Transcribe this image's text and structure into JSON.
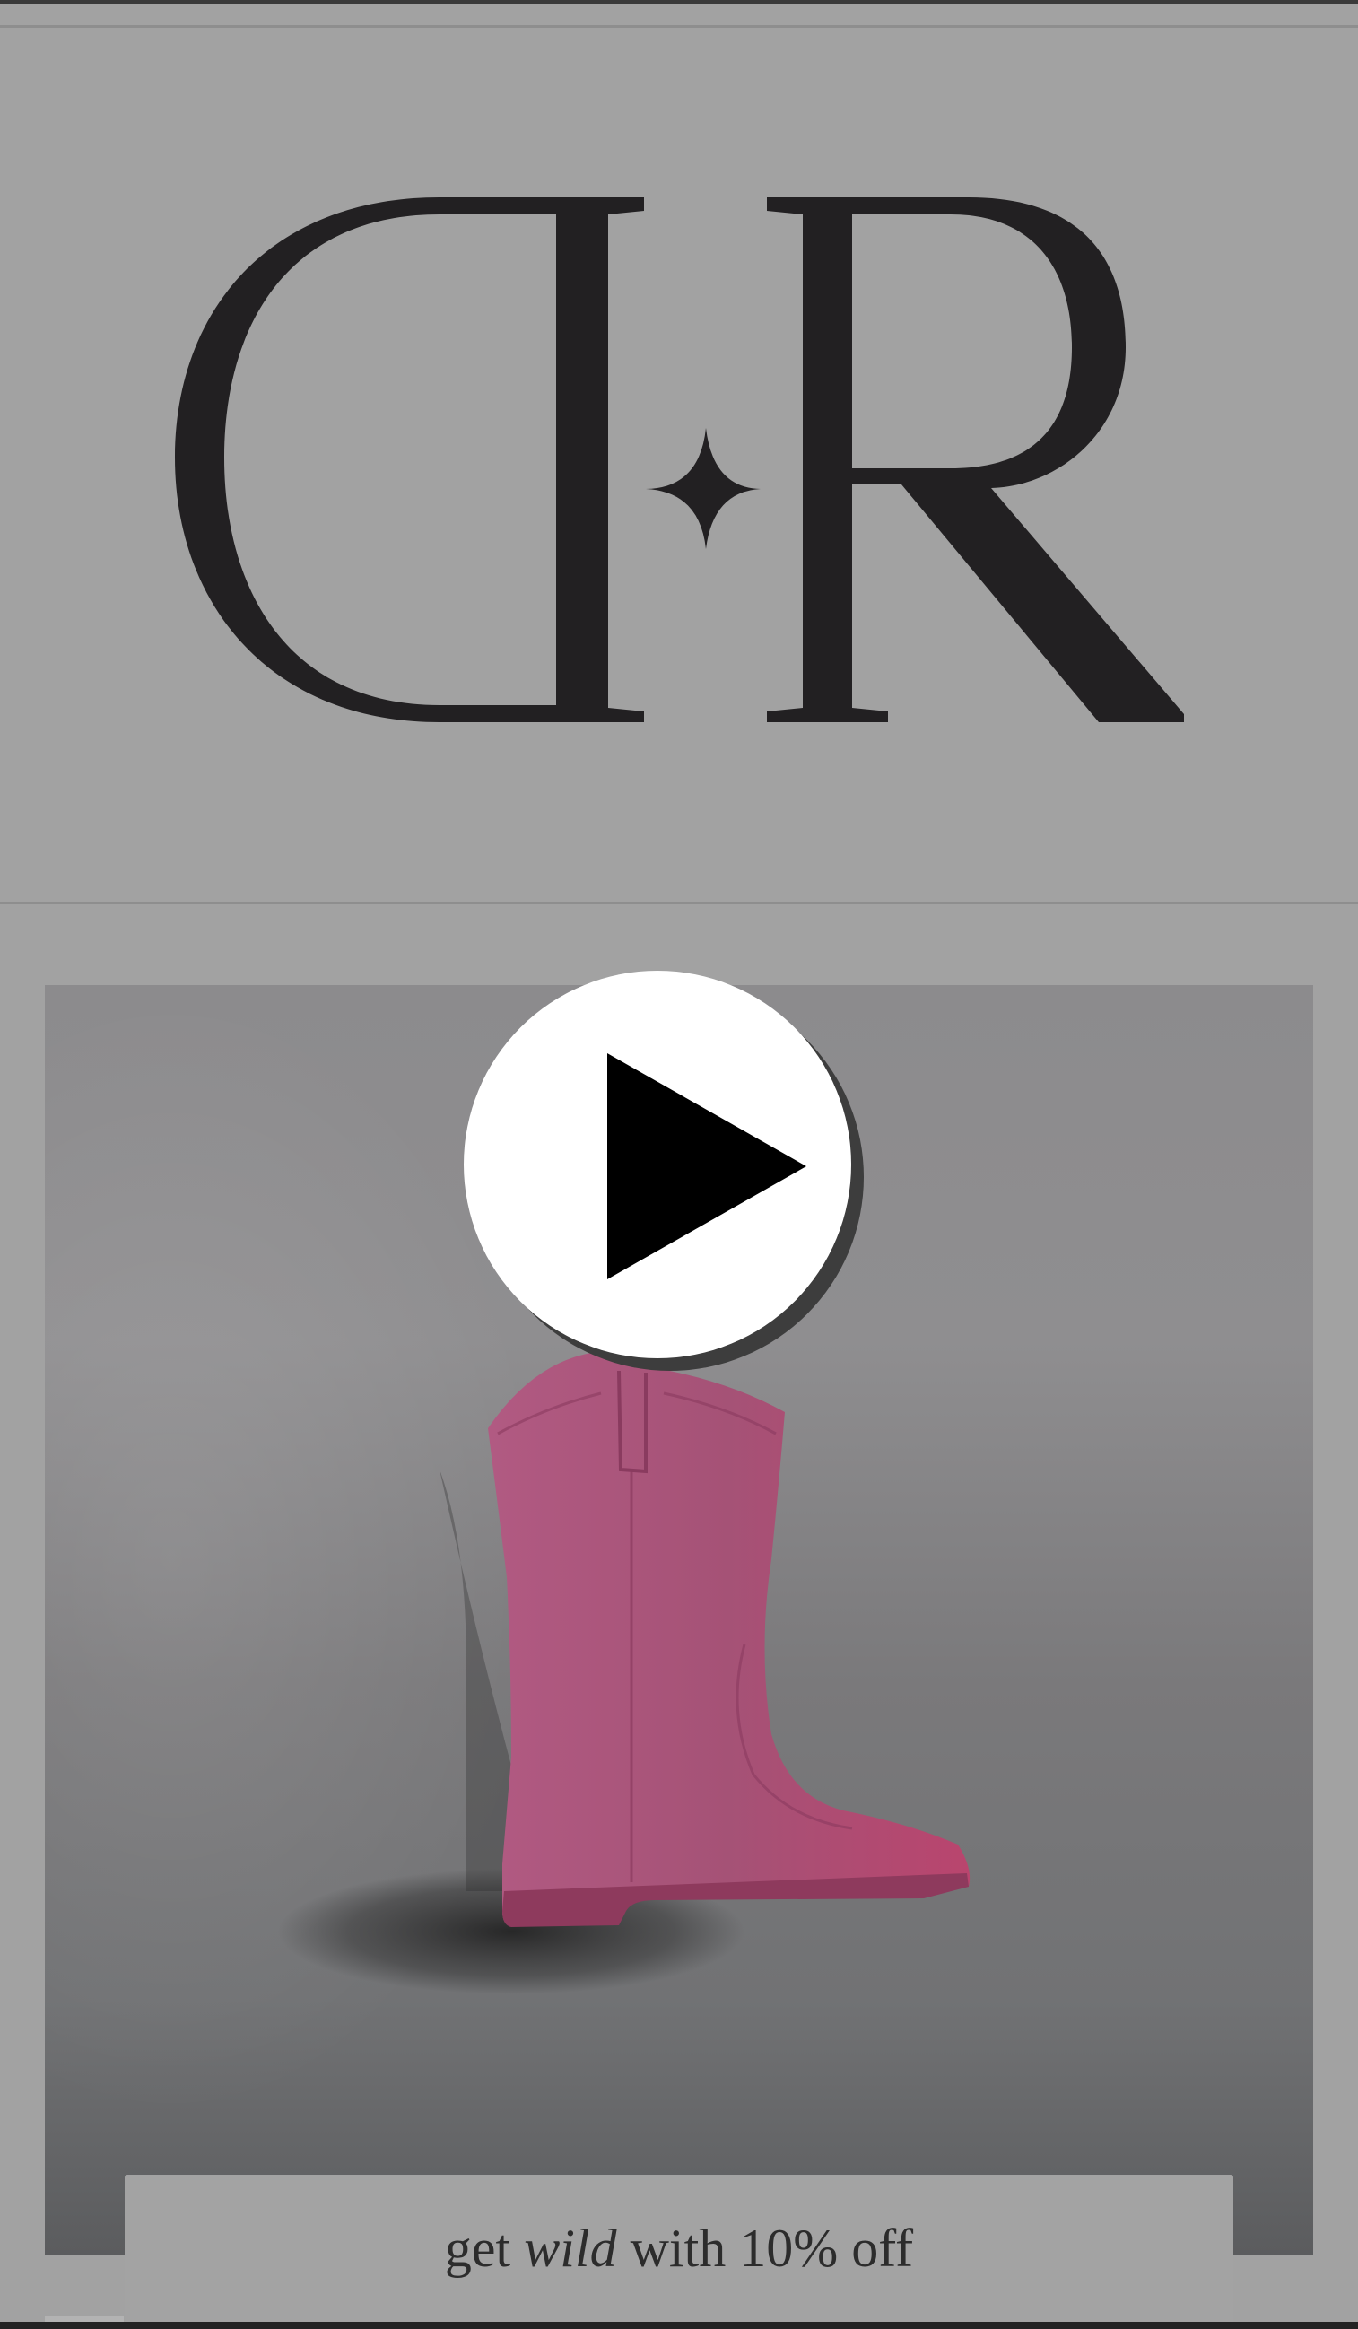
{
  "header": {
    "logo": {
      "icon": "dr-monogram-logo",
      "text": "DR"
    }
  },
  "hero": {
    "media": "pink-cowboy-boot-video",
    "play_icon": "play-icon"
  },
  "promo": {
    "prefix": "get",
    "emphasis": "wild",
    "suffix": "with 10% off"
  },
  "colors": {
    "page_background": "#a2a2a2",
    "logo_ink": "#222022",
    "boot_pink": "#a55276",
    "play_button_fill": "#ffffff",
    "play_icon_fill": "#000000",
    "promo_text": "#2c2c2c"
  }
}
